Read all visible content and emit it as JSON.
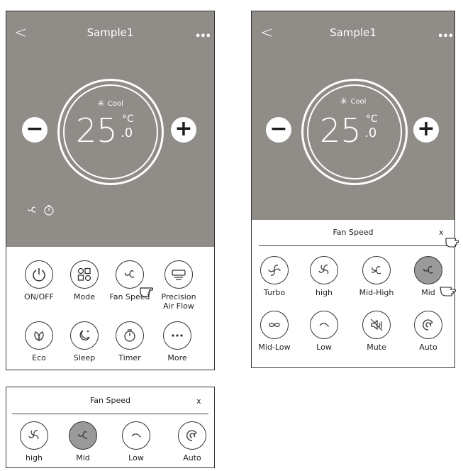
{
  "app": {
    "title": "Sample1",
    "back_glyph": "<",
    "more_glyph": "•••"
  },
  "thermostat": {
    "mode_glyph": "✳",
    "mode_label": "Cool",
    "temperature": "25",
    "unit": "°C",
    "fraction": ".0",
    "minus_glyph": "−",
    "plus_glyph": "+"
  },
  "status_icons": [
    "fan-icon",
    "timer-icon"
  ],
  "control_buttons": [
    {
      "label": "ON/OFF",
      "icon": "power-icon"
    },
    {
      "label": "Mode",
      "icon": "mode-grid-icon"
    },
    {
      "label": "Fan Speed",
      "icon": "fan-icon"
    },
    {
      "label": "Precision\nAir Flow",
      "icon": "airflow-icon"
    },
    {
      "label": "Eco",
      "icon": "leaf-icon"
    },
    {
      "label": "Sleep",
      "icon": "moon-icon"
    },
    {
      "label": "Timer",
      "icon": "timer-icon"
    },
    {
      "label": "More",
      "icon": "ellipsis-icon"
    }
  ],
  "fan_speed_panel": {
    "title": "Fan Speed",
    "close": "x",
    "options": [
      {
        "label": "Turbo",
        "icon": "fan-turbo-icon",
        "selected": false
      },
      {
        "label": "high",
        "icon": "fan-high-icon",
        "selected": false
      },
      {
        "label": "Mid-High",
        "icon": "fan-mid-high-icon",
        "selected": false
      },
      {
        "label": "Mid",
        "icon": "fan-mid-icon",
        "selected": true
      },
      {
        "label": "Mid-Low",
        "icon": "fan-mid-low-icon",
        "selected": false
      },
      {
        "label": "Low",
        "icon": "fan-low-icon",
        "selected": false
      },
      {
        "label": "Mute",
        "icon": "mute-icon",
        "selected": false
      },
      {
        "label": "Auto",
        "icon": "auto-icon",
        "selected": false
      }
    ]
  },
  "fan_speed_panel_compact": {
    "title": "Fan Speed",
    "close": "x",
    "options": [
      {
        "label": "high",
        "icon": "fan-high-icon",
        "selected": false
      },
      {
        "label": "Mid",
        "icon": "fan-mid-icon",
        "selected": true
      },
      {
        "label": "Low",
        "icon": "fan-low-icon",
        "selected": false
      },
      {
        "label": "Auto",
        "icon": "auto-icon",
        "selected": false
      }
    ]
  },
  "colors": {
    "header_gray": "#908c88",
    "selected_gray": "#9a9a9a",
    "stroke": "#333333"
  }
}
